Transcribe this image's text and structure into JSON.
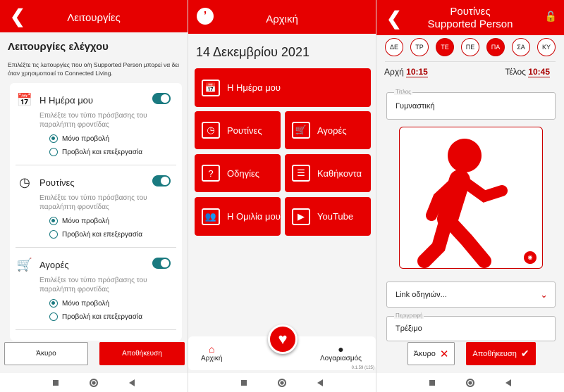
{
  "panel1": {
    "header_title": "Λειτουργίες",
    "heading": "Λειτουργίες ελέγχου",
    "intro": "Επιλέξτε τις λειτουργίες που ο/η Supported Person μπορεί να δει όταν χρησιμοποιεί το Connected Living.",
    "features": [
      {
        "name": "Η Ημέρα μου",
        "icon": "calendar-icon",
        "enabled": true,
        "desc": "Επιλέξτε τον τύπο πρόσβασης του παραλήπτη φροντίδας",
        "options": [
          "Μόνο προβολή",
          "Προβολή και επεξεργασία"
        ],
        "selected": 0
      },
      {
        "name": "Ρουτίνες",
        "icon": "routine-icon",
        "enabled": true,
        "desc": "Επιλέξτε τον τύπο πρόσβασης του παραλήπτη φροντίδας",
        "options": [
          "Μόνο προβολή",
          "Προβολή και επεξεργασία"
        ],
        "selected": 0
      },
      {
        "name": "Αγορές",
        "icon": "cart-icon",
        "enabled": true,
        "desc": "Επιλέξτε τον τύπο πρόσβασης του παραλήπτη φροντίδας",
        "options": [
          "Μόνο προβολή",
          "Προβολή και επεξεργασία"
        ],
        "selected": 0
      }
    ],
    "cancel": "Άκυρο",
    "save": "Αποθήκευση"
  },
  "panel2": {
    "header_title": "Αρχική",
    "date": "14 Δεκεμβρίου 2021",
    "tiles": [
      {
        "label": "Η Ημέρα μου",
        "icon": "calendar-icon"
      },
      {
        "label": "Ρουτίνες",
        "icon": "routine-icon"
      },
      {
        "label": "Αγορές",
        "icon": "cart-icon"
      },
      {
        "label": "Οδηγίες",
        "icon": "help-icon"
      },
      {
        "label": "Καθήκοντα",
        "icon": "checklist-icon"
      },
      {
        "label": "Η Ομιλία μου",
        "icon": "speech-icon"
      },
      {
        "label": "YouTube",
        "icon": "youtube-icon"
      }
    ],
    "nav_home": "Αρχική",
    "nav_account": "Λογαριασμός",
    "version": "0.1.59 (125)"
  },
  "panel3": {
    "header_title": "Ρουτίνες",
    "header_subtitle": "Supported Person",
    "days": [
      {
        "label": "ΔΕ",
        "on": false
      },
      {
        "label": "ΤΡ",
        "on": false
      },
      {
        "label": "ΤΕ",
        "on": true
      },
      {
        "label": "ΠΕ",
        "on": false
      },
      {
        "label": "ΠΑ",
        "on": true
      },
      {
        "label": "ΣΑ",
        "on": false
      },
      {
        "label": "ΚΥ",
        "on": false
      }
    ],
    "start_label": "Αρχή",
    "start": "10:15",
    "end_label": "Τέλος",
    "end": "10:45",
    "title_label": "Τίτλος",
    "title_value": "Γυμναστική",
    "link_placeholder": "Link οδηγιών...",
    "desc_label": "Περιγραφή",
    "desc_value": "Τρέξιμο",
    "cancel": "Άκυρο",
    "save": "Αποθήκευση"
  },
  "colors": {
    "brand": "#e60000",
    "toggle": "#1a7a80"
  }
}
